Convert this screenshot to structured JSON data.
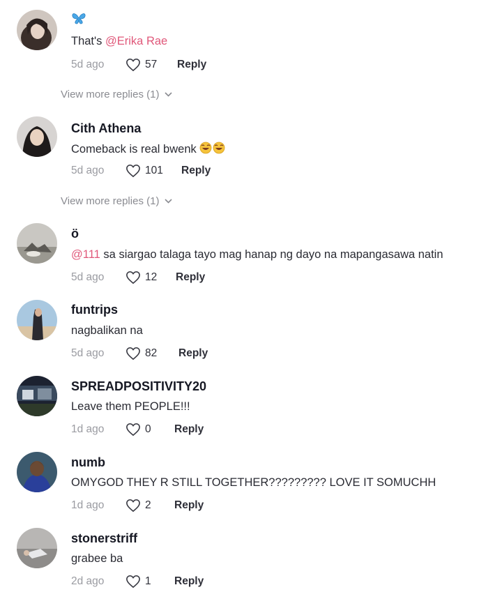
{
  "comments": [
    {
      "name": "🦋",
      "mention": "@Erika Rae",
      "text_before": "That's ",
      "text": "",
      "time": "5d ago",
      "likes": "57",
      "reply": "Reply",
      "view_more": "View more replies (1)"
    },
    {
      "name": "Cith Athena",
      "text": "Comeback is real bwenk",
      "time": "5d ago",
      "likes": "101",
      "reply": "Reply",
      "view_more": "View more replies (1)"
    },
    {
      "name": "ö",
      "mention": "@111",
      "text": " sa siargao talaga tayo mag hanap ng dayo na mapangasawa natin",
      "time": "5d ago",
      "likes": "12",
      "reply": "Reply"
    },
    {
      "name": "funtrips",
      "text": "nagbalikan na",
      "time": "5d ago",
      "likes": "82",
      "reply": "Reply"
    },
    {
      "name": "SPREADPOSITIVITY20",
      "text": "Leave them PEOPLE!!!",
      "time": "1d ago",
      "likes": "0",
      "reply": "Reply"
    },
    {
      "name": "numb",
      "text": "OMYGOD THEY R STILL TOGETHER????????? LOVE IT SOMUCHH",
      "time": "1d ago",
      "likes": "2",
      "reply": "Reply"
    },
    {
      "name": "stonerstriff",
      "text": "grabee ba",
      "time": "2d ago",
      "likes": "1",
      "reply": "Reply"
    }
  ],
  "icons": {
    "like": "heart-outline-icon",
    "expand": "chevron-down-icon",
    "emoji": "tears-of-joy-emoji"
  },
  "colors": {
    "mention": "#e0587a",
    "timestamp": "#9a9ba1",
    "name": "#161823"
  }
}
